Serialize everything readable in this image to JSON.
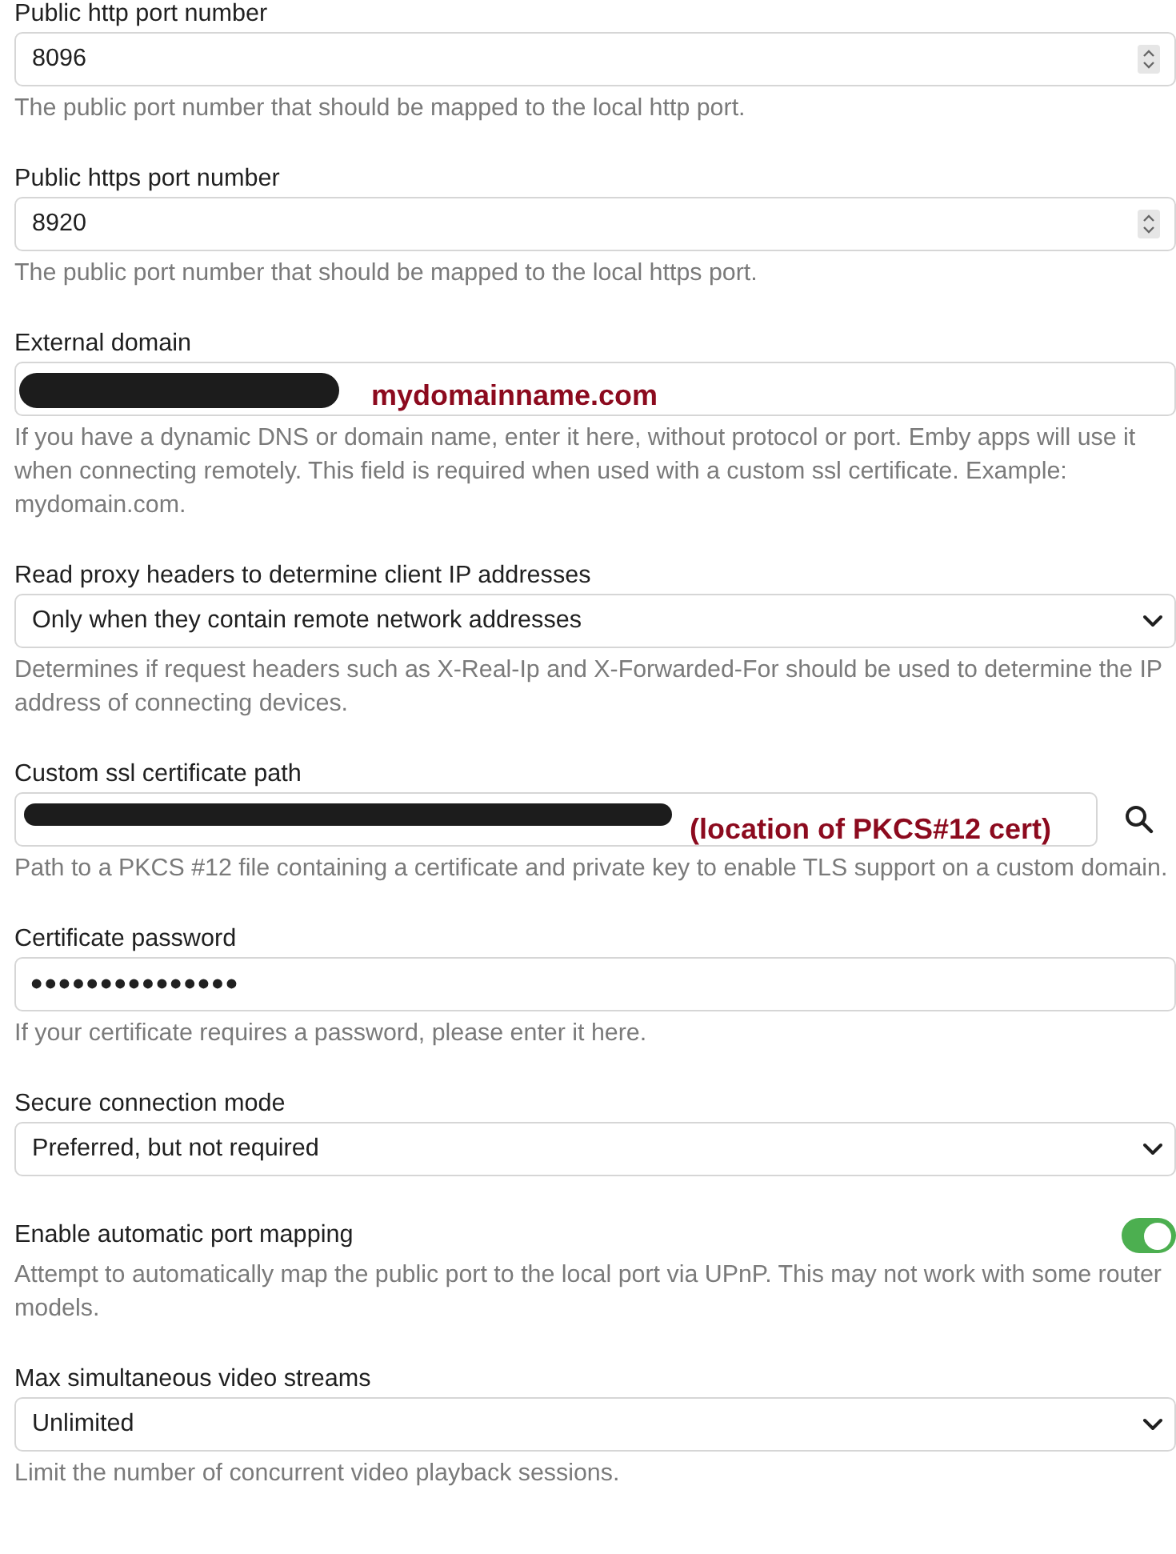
{
  "settings": [
    {
      "kind": "number",
      "label": "Public http port number",
      "value": "8096",
      "description": "The public port number that should be mapped to the local http port."
    },
    {
      "kind": "number",
      "label": "Public https port number",
      "value": "8920",
      "description": "The public port number that should be mapped to the local https port."
    },
    {
      "kind": "text",
      "label": "External domain",
      "redacted": true,
      "annotation": "mydomainname.com",
      "description": "If you have a dynamic DNS or domain name, enter it here, without protocol or port. Emby apps will use it when connecting remotely. This field is required when used with a custom ssl certificate. Example: mydomain.com."
    },
    {
      "kind": "select",
      "label": "Read proxy headers to determine client IP addresses",
      "value": "Only when they contain remote network addresses",
      "description": "Determines if request headers such as X-Real-Ip and X-Forwarded-For should be used to determine the IP address of connecting devices."
    },
    {
      "kind": "path",
      "label": "Custom ssl certificate path",
      "redacted": true,
      "annotation": "(location of PKCS#12 cert)",
      "description": "Path to a PKCS #12 file containing a certificate and private key to enable TLS support on a custom domain."
    },
    {
      "kind": "password",
      "label": "Certificate password",
      "value": "•••••••••••••••",
      "description": "If your certificate requires a password, please enter it here."
    },
    {
      "kind": "select",
      "label": "Secure connection mode",
      "value": "Preferred, but not required"
    },
    {
      "kind": "toggle",
      "label": "Enable automatic port mapping",
      "on": true,
      "description": "Attempt to automatically map the public port to the local port via UPnP. This may not work with some router models."
    },
    {
      "kind": "select",
      "label": "Max simultaneous video streams",
      "value": "Unlimited",
      "description": "Limit the number of concurrent video playback sessions."
    }
  ]
}
